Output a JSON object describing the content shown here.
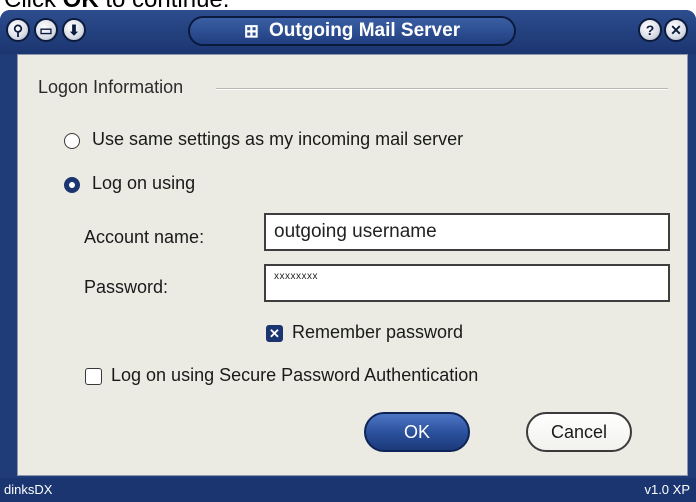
{
  "caption": {
    "prefix": "Click ",
    "bold": "OK",
    "suffix": " to continue."
  },
  "window": {
    "title": "Outgoing Mail Server",
    "title_icon": "windows-flag-icon"
  },
  "titlebar_buttons": {
    "left": [
      "pin-icon",
      "minimize-icon",
      "restore-icon"
    ],
    "right": [
      "help-icon",
      "close-icon"
    ]
  },
  "logon": {
    "group_label": "Logon Information",
    "options": [
      {
        "label": "Use same settings as my incoming mail server",
        "checked": false
      },
      {
        "label": "Log on using",
        "checked": true
      }
    ]
  },
  "fields": {
    "account_label": "Account name:",
    "account_value": "outgoing username",
    "password_label": "Password:",
    "password_value": "xxxxxxxx"
  },
  "remember_password": {
    "label": "Remember password",
    "checked": true
  },
  "spa": {
    "label": "Log on using Secure Password Authentication",
    "checked": false
  },
  "buttons": {
    "ok": "OK",
    "cancel": "Cancel"
  },
  "status": {
    "left": "dinksDX",
    "right": "v1.0 XP"
  },
  "colors": {
    "frame": "#1f3c78",
    "client": "#ebebe4",
    "accent": "#2a4f9a"
  }
}
